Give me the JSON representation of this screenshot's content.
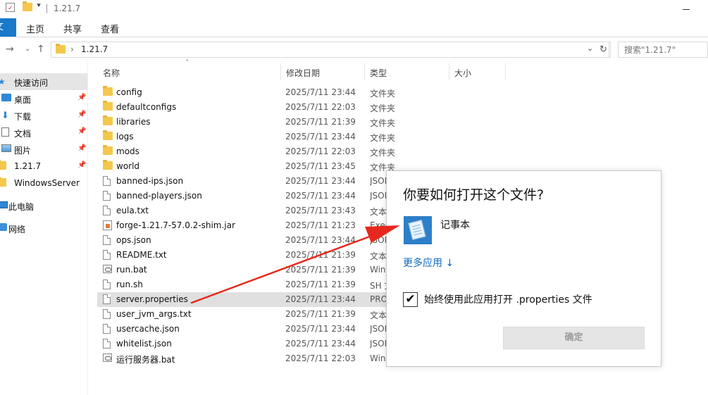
{
  "window": {
    "title": "1.21.7"
  },
  "ribbon": {
    "file_tab": "文件",
    "tabs": [
      "主页",
      "共享",
      "查看"
    ]
  },
  "address": {
    "crumb": "1.21.7",
    "search_placeholder": "搜索\"1.21.7\""
  },
  "sidebar": {
    "items": [
      {
        "label": "快速访问",
        "icon": "star-icon",
        "pinned": false
      },
      {
        "label": "桌面",
        "icon": "desktop-icon",
        "pinned": true
      },
      {
        "label": "下载",
        "icon": "download-icon",
        "pinned": true
      },
      {
        "label": "文档",
        "icon": "document-icon",
        "pinned": true
      },
      {
        "label": "图片",
        "icon": "pictures-icon",
        "pinned": true
      },
      {
        "label": "1.21.7",
        "icon": "folder-icon",
        "pinned": true
      },
      {
        "label": "WindowsServer",
        "icon": "folder-icon",
        "pinned": false
      },
      {
        "label": "此电脑",
        "icon": "this-pc-icon",
        "pinned": false
      },
      {
        "label": "网络",
        "icon": "network-icon",
        "pinned": false
      }
    ]
  },
  "columns": {
    "name": "名称",
    "date": "修改日期",
    "type": "类型",
    "size": "大小"
  },
  "files": [
    {
      "name": "config",
      "date": "2025/7/11 23:44",
      "type": "文件夹",
      "icon": "folder"
    },
    {
      "name": "defaultconfigs",
      "date": "2025/7/11 22:03",
      "type": "文件夹",
      "icon": "folder"
    },
    {
      "name": "libraries",
      "date": "2025/7/11 21:39",
      "type": "文件夹",
      "icon": "folder"
    },
    {
      "name": "logs",
      "date": "2025/7/11 23:44",
      "type": "文件夹",
      "icon": "folder"
    },
    {
      "name": "mods",
      "date": "2025/7/11 22:03",
      "type": "文件夹",
      "icon": "folder"
    },
    {
      "name": "world",
      "date": "2025/7/11 23:45",
      "type": "文件夹",
      "icon": "folder"
    },
    {
      "name": "banned-ips.json",
      "date": "2025/7/11 23:44",
      "type": "JSON",
      "icon": "file"
    },
    {
      "name": "banned-players.json",
      "date": "2025/7/11 23:44",
      "type": "JSON",
      "icon": "file"
    },
    {
      "name": "eula.txt",
      "date": "2025/7/11 23:43",
      "type": "文本",
      "icon": "file"
    },
    {
      "name": "forge-1.21.7-57.0.2-shim.jar",
      "date": "2025/7/11 21:23",
      "type": "Exec",
      "icon": "jar"
    },
    {
      "name": "ops.json",
      "date": "2025/7/11 23:44",
      "type": "JSON",
      "icon": "file"
    },
    {
      "name": "README.txt",
      "date": "2025/7/11 21:39",
      "type": "文本",
      "icon": "file"
    },
    {
      "name": "run.bat",
      "date": "2025/7/11 21:39",
      "type": "Win",
      "icon": "bat"
    },
    {
      "name": "run.sh",
      "date": "2025/7/11 21:39",
      "type": "SH 文",
      "icon": "file"
    },
    {
      "name": "server.properties",
      "date": "2025/7/11 23:44",
      "type": "PRO",
      "icon": "file",
      "selected": true
    },
    {
      "name": "user_jvm_args.txt",
      "date": "2025/7/11 21:39",
      "type": "文本",
      "icon": "file"
    },
    {
      "name": "usercache.json",
      "date": "2025/7/11 23:44",
      "type": "JSON",
      "icon": "file"
    },
    {
      "name": "whitelist.json",
      "date": "2025/7/11 23:44",
      "type": "JSON",
      "icon": "file"
    },
    {
      "name": "运行服务器.bat",
      "date": "2025/7/11 22:03",
      "type": "Win",
      "icon": "bat"
    }
  ],
  "dialog": {
    "title": "你要如何打开这个文件?",
    "app_name": "记事本",
    "more_apps": "更多应用 ↓",
    "always_use_label": "始终使用此应用打开 .properties 文件",
    "always_use_checked": true,
    "ok_label": "确定"
  },
  "colors": {
    "accent": "#1979ca",
    "arrow": "#e8281e",
    "link": "#0e6ac0"
  }
}
